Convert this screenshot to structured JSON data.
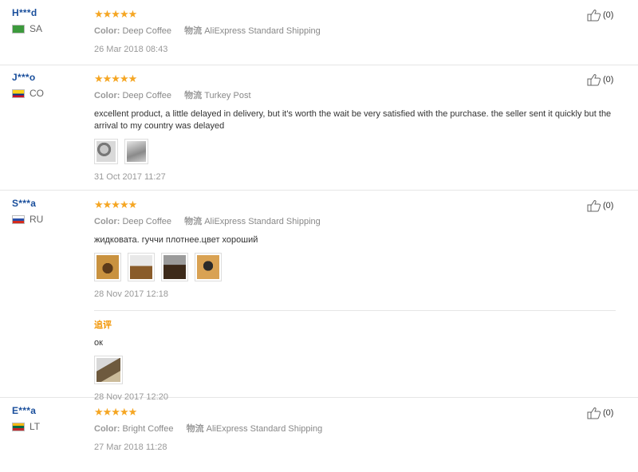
{
  "labels": {
    "color": "Color:",
    "logistics": "物流"
  },
  "reviews": [
    {
      "user": "H***d",
      "country": "SA",
      "stars": "★★★★★",
      "color": "Deep Coffee",
      "shipping": "AliExpress Standard Shipping",
      "date": "26 Mar 2018 08:43",
      "likes": "(0)"
    },
    {
      "user": "J***o",
      "country": "CO",
      "stars": "★★★★★",
      "color": "Deep Coffee",
      "shipping": "Turkey Post",
      "comment": "excellent product, a little delayed in delivery, but it's worth the wait be very satisfied with the purchase. the seller sent it quickly but the arrival to my country was delayed",
      "date": "31 Oct 2017 11:27",
      "likes": "(0)"
    },
    {
      "user": "S***a",
      "country": "RU",
      "stars": "★★★★★",
      "color": "Deep Coffee",
      "shipping": "AliExpress Standard Shipping",
      "comment": "жидковата. гуччи плотнее.цвет хороший",
      "date": "28 Nov 2017 12:18",
      "likes": "(0)",
      "followup": {
        "title": "追评",
        "comment": "ок",
        "date": "28 Nov 2017 12:20"
      }
    },
    {
      "user": "E***a",
      "country": "LT",
      "stars": "★★★★★",
      "color": "Bright Coffee",
      "shipping": "AliExpress Standard Shipping",
      "date": "27 Mar 2018 11:28",
      "likes": "(0)"
    }
  ]
}
